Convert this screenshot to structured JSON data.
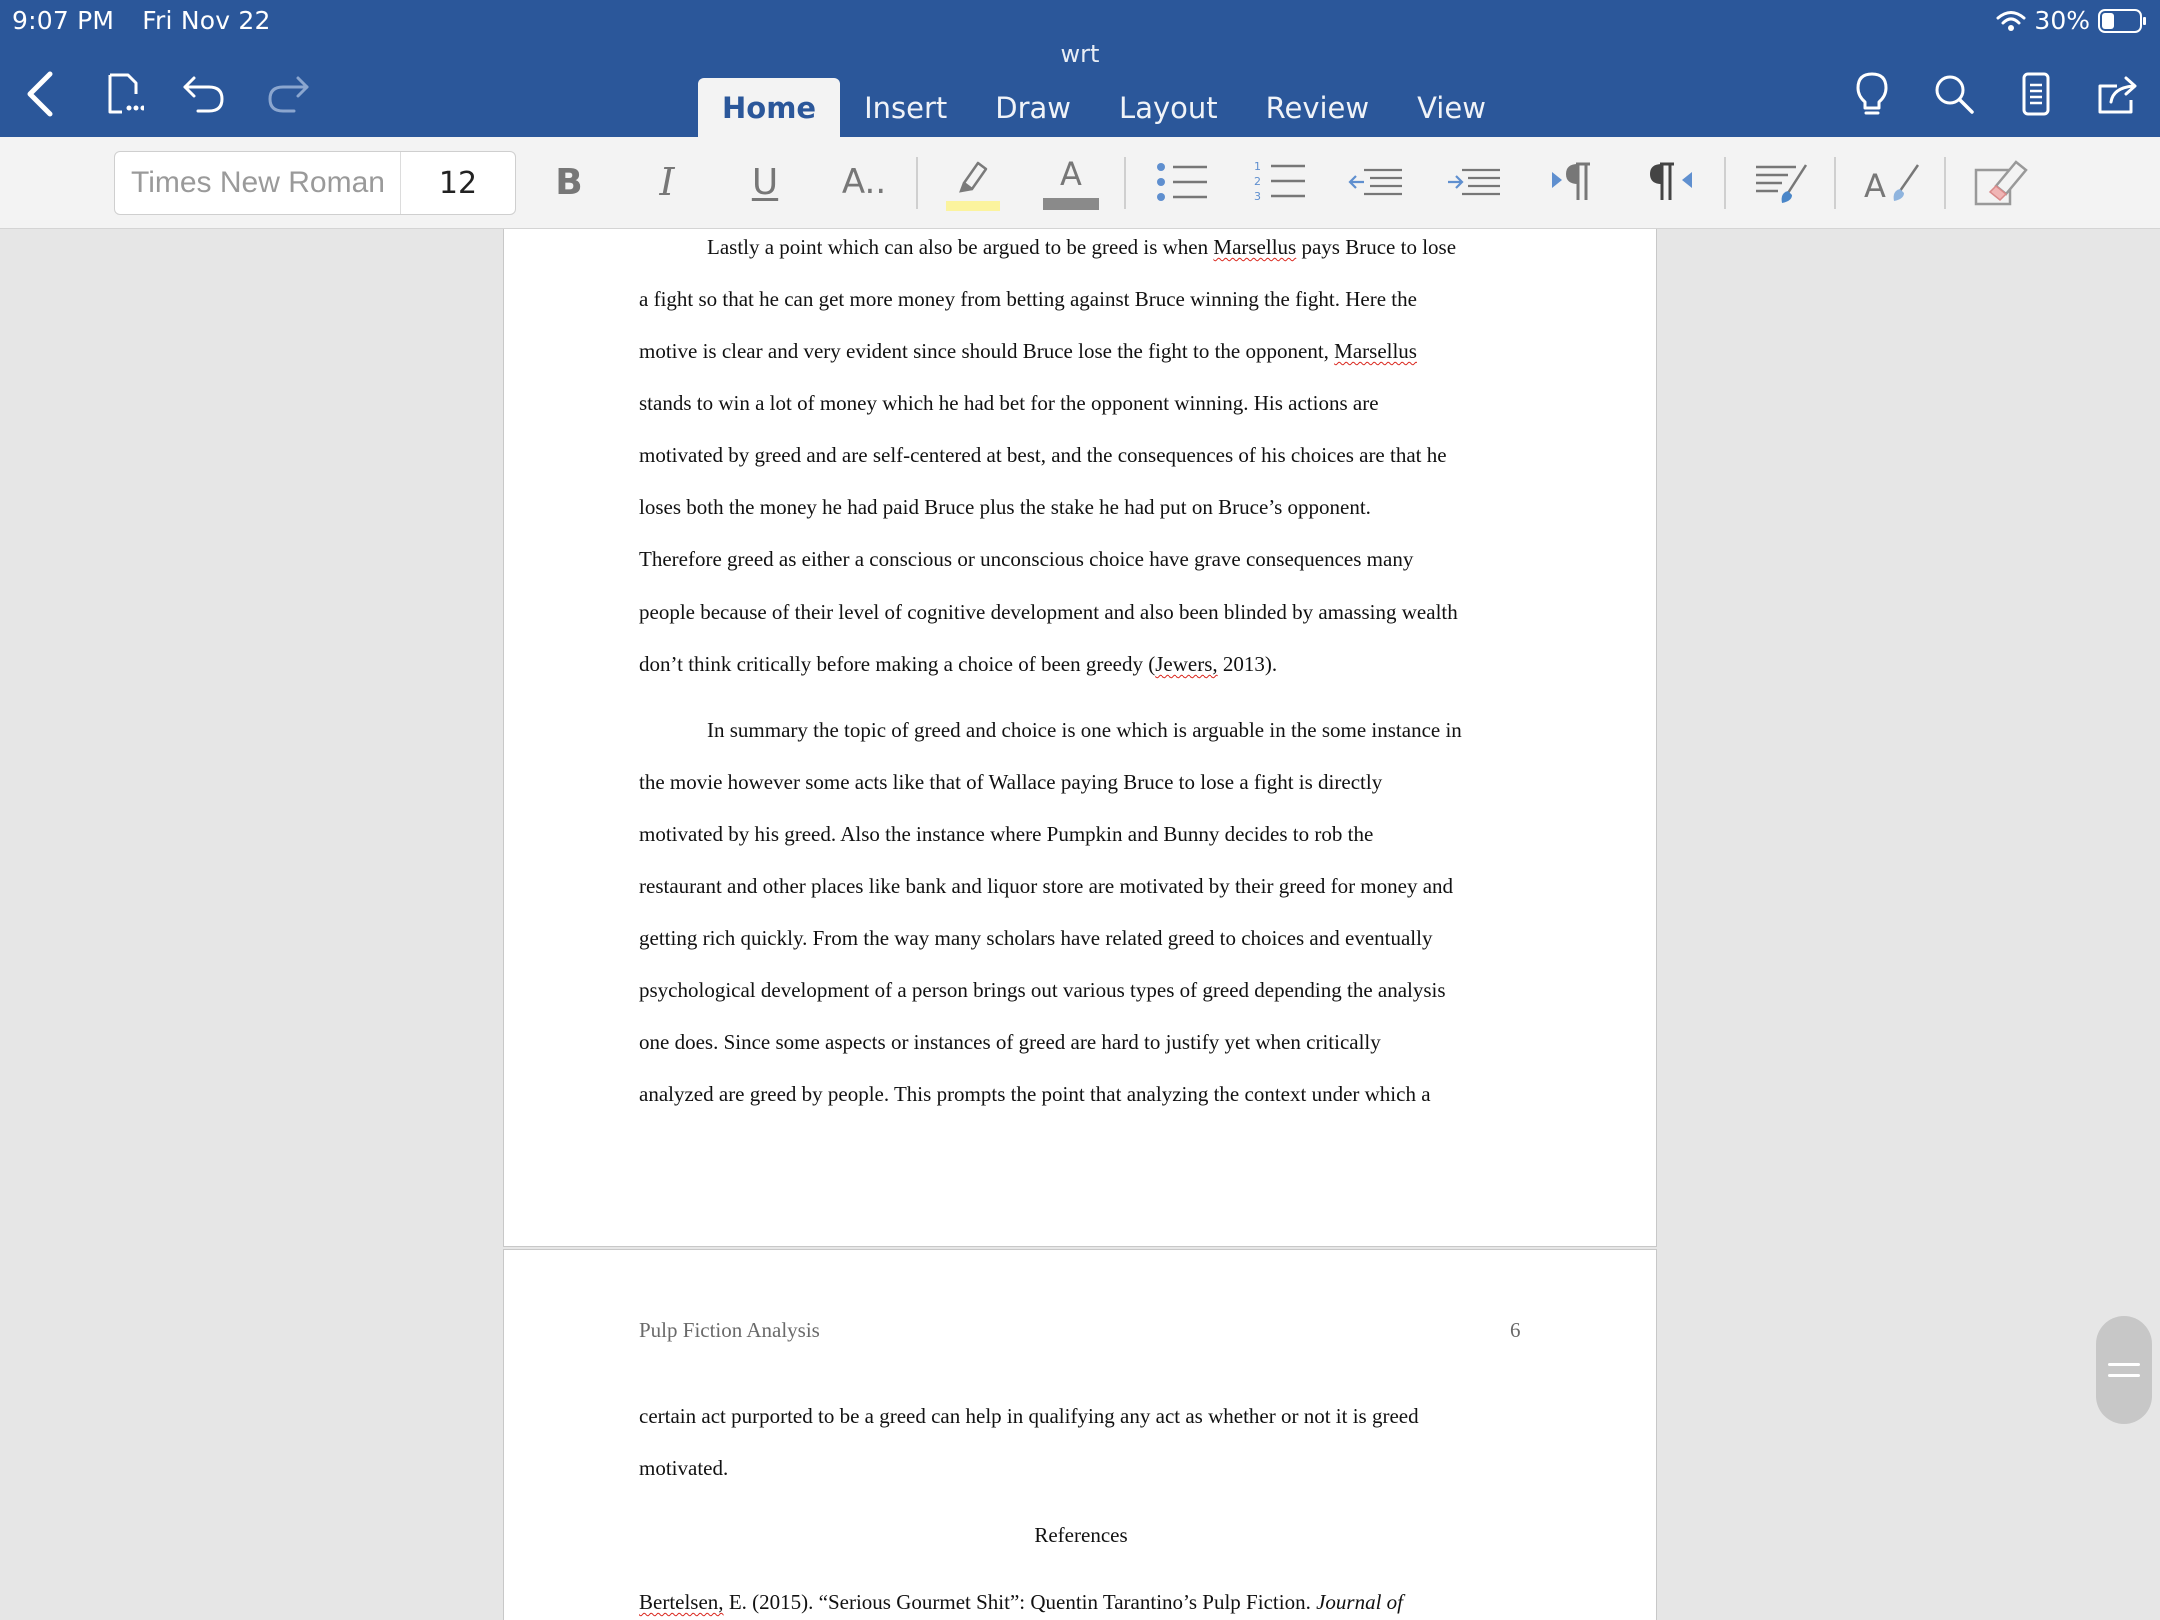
{
  "status_bar": {
    "time": "9:07 PM",
    "date": "Fri Nov 22",
    "battery": "30%"
  },
  "title_bar": {
    "doc_title": "wrt"
  },
  "tabs": [
    {
      "label": "Home"
    },
    {
      "label": "Insert"
    },
    {
      "label": "Draw"
    },
    {
      "label": "Layout"
    },
    {
      "label": "Review"
    },
    {
      "label": "View"
    }
  ],
  "ribbon": {
    "font_name": "Times New Roman",
    "font_size": "12",
    "bold": "B",
    "italic": "I",
    "underline": "U",
    "more_formatting": "A..",
    "font_color_glyph": "A",
    "highlight_color": "#fbf39e",
    "font_color": "#8a8a8a",
    "accent_color": "#2b579a"
  },
  "document": {
    "page1_lines": [
      "Lastly a point which can also be argued to be greed is when ",
      "a fight so that he can get more money from betting against Bruce winning the fight. Here the",
      "motive is clear and very evident since should Bruce lose the fight to the opponent, ",
      "stands to win a lot of money which he had bet for the opponent winning. His actions are",
      "motivated by greed and are self-centered at best, and the consequences of his choices are that he",
      "loses both the money he had paid Bruce plus the stake he had put on Bruce’s opponent.",
      "Therefore greed as either a conscious or unconscious choice have grave consequences many",
      "people because of their level of cognitive development and also been blinded by amassing wealth",
      "don’t think critically before making a choice of been greedy (",
      "In summary the topic of greed and choice is one which is arguable in the some instance in",
      "the movie however some acts like that of Wallace paying Bruce to lose a fight is directly",
      "motivated by his greed. Also the instance where Pumpkin and Bunny decides to rob the",
      "restaurant and other places like bank and liquor store are motivated by their greed for money and",
      "getting rich quickly. From the way many scholars have related greed to choices and eventually",
      "psychological development of a person brings out various types of greed depending the analysis",
      "one does. Since some aspects or instances of greed are hard to justify yet when critically",
      "analyzed are greed by people. This prompts the point that analyzing the context under which a"
    ],
    "misspelled_marsellus": "Marsellus",
    "line1_tail": " pays Bruce to lose",
    "misspelled_jewers": "Jewers,",
    "line9_tail": " 2013).",
    "page2_header_left": "Pulp Fiction Analysis",
    "page2_header_right": "6",
    "page2_lines": [
      "certain act purported to be a greed can help in qualifying any act as whether or not it is greed",
      "motivated."
    ],
    "references_title": "References",
    "ref1_author": "Bertelsen,",
    "ref1_text": " E. (2015). “Serious Gourmet Shit”: Quentin Tarantino’s Pulp Fiction. ",
    "ref1_journal": "Journal of"
  }
}
